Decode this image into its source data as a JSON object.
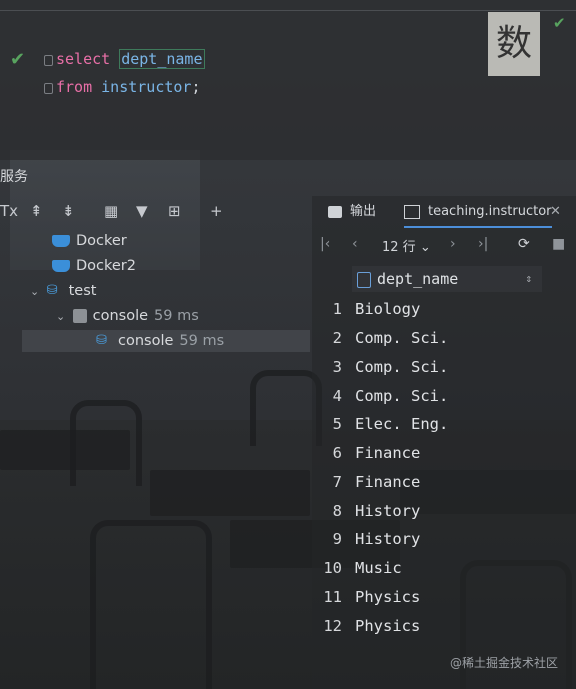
{
  "editor": {
    "line1": {
      "kw": "select",
      "ident": "dept_name"
    },
    "line2": {
      "kw": "from",
      "ident": "instructor",
      "end": ";"
    },
    "badge_char": "数"
  },
  "services": {
    "title": "服务",
    "left_edge_label": "Tx",
    "tree": [
      {
        "label": "Docker",
        "icon": "docker-icon"
      },
      {
        "label": "Docker2",
        "icon": "docker-icon"
      },
      {
        "label": "test",
        "icon": "database-icon",
        "expanded": true
      },
      {
        "label": "console",
        "time": "59 ms",
        "icon": "console-icon",
        "expanded": true
      },
      {
        "label": "console",
        "time": "59 ms",
        "icon": "database-icon",
        "selected": true
      }
    ]
  },
  "results": {
    "tabs": [
      {
        "label": "输出",
        "icon": "output-icon"
      },
      {
        "label": "teaching.instructor",
        "icon": "table-icon",
        "active": true
      }
    ],
    "rows_label": "12 行",
    "column": "dept_name",
    "rows": [
      {
        "n": "1",
        "v": "Biology"
      },
      {
        "n": "2",
        "v": "Comp. Sci."
      },
      {
        "n": "3",
        "v": "Comp. Sci."
      },
      {
        "n": "4",
        "v": "Comp. Sci."
      },
      {
        "n": "5",
        "v": "Elec. Eng."
      },
      {
        "n": "6",
        "v": "Finance"
      },
      {
        "n": "7",
        "v": "Finance"
      },
      {
        "n": "8",
        "v": "History"
      },
      {
        "n": "9",
        "v": "History"
      },
      {
        "n": "10",
        "v": "Music"
      },
      {
        "n": "11",
        "v": "Physics"
      },
      {
        "n": "12",
        "v": "Physics"
      }
    ]
  },
  "watermark": "@稀土掘金技术社区"
}
